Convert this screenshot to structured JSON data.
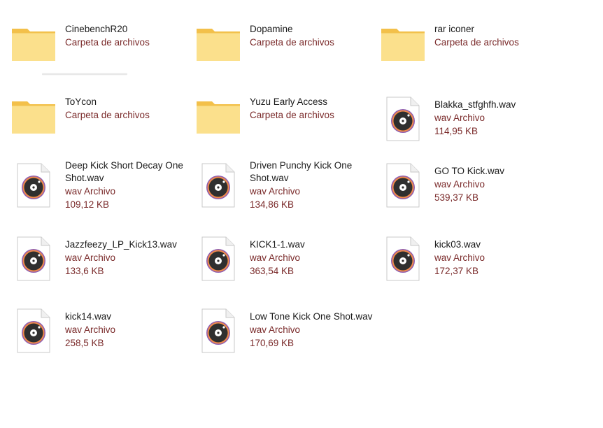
{
  "files": [
    {
      "name": "CinebenchR20",
      "type": "Carpeta de archivos",
      "size": "",
      "kind": "folder"
    },
    {
      "name": "Dopamine",
      "type": "Carpeta de archivos",
      "size": "",
      "kind": "folder"
    },
    {
      "name": "rar iconer",
      "type": "Carpeta de archivos",
      "size": "",
      "kind": "folder"
    },
    {
      "name": "ToYcon",
      "type": "Carpeta de archivos",
      "size": "",
      "kind": "folder"
    },
    {
      "name": "Yuzu Early Access",
      "type": "Carpeta de archivos",
      "size": "",
      "kind": "folder"
    },
    {
      "name": "Blakka_stfghfh.wav",
      "type": "wav Archivo",
      "size": "114,95 KB",
      "kind": "wav"
    },
    {
      "name": "Deep Kick Short Decay One Shot.wav",
      "type": "wav Archivo",
      "size": "109,12 KB",
      "kind": "wav"
    },
    {
      "name": "Driven Punchy Kick One Shot.wav",
      "type": "wav Archivo",
      "size": "134,86 KB",
      "kind": "wav"
    },
    {
      "name": "GO TO Kick.wav",
      "type": "wav Archivo",
      "size": "539,37 KB",
      "kind": "wav"
    },
    {
      "name": "Jazzfeezy_LP_Kick13.wav",
      "type": "wav Archivo",
      "size": "133,6 KB",
      "kind": "wav"
    },
    {
      "name": "KICK1-1.wav",
      "type": "wav Archivo",
      "size": "363,54 KB",
      "kind": "wav"
    },
    {
      "name": "kick03.wav",
      "type": "wav Archivo",
      "size": "172,37 KB",
      "kind": "wav"
    },
    {
      "name": "kick14.wav",
      "type": "wav Archivo",
      "size": "258,5 KB",
      "kind": "wav"
    },
    {
      "name": "Low Tone Kick One Shot.wav",
      "type": "wav Archivo",
      "size": "170,69 KB",
      "kind": "wav"
    }
  ],
  "colors": {
    "folder": "#f8d775",
    "folder_tab": "#e8b53a",
    "type_text": "#7a2a2a",
    "disc_ring": "#e0784a"
  }
}
